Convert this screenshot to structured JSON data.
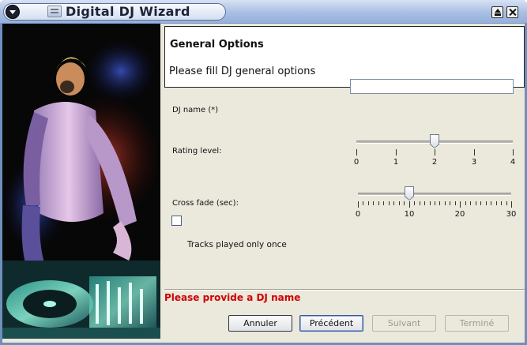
{
  "window": {
    "title": "Digital DJ Wizard"
  },
  "header": {
    "title": "General Options",
    "subtitle": "Please fill DJ general options"
  },
  "form": {
    "dj_name_label": "DJ name (*)",
    "dj_name_value": "",
    "rating_label": "Rating level:",
    "rating_ticks": [
      "0",
      "1",
      "2",
      "3",
      "4"
    ],
    "rating_value": 2,
    "crossfade_label": "Cross fade (sec):",
    "crossfade_ticks": [
      "0",
      "10",
      "20",
      "30"
    ],
    "crossfade_value": 10,
    "once_label": "Tracks played only once",
    "once_checked": false
  },
  "status": {
    "error": "Please provide a DJ name",
    "error_color": "#d00000"
  },
  "buttons": {
    "cancel": "Annuler",
    "previous": "Précédent",
    "next": "Suivant",
    "finish": "Terminé"
  },
  "icons": {
    "window_menu": "chevron-down-icon",
    "app": "wizard-app-icon",
    "maximize": "maximize-icon",
    "close": "close-icon"
  },
  "colors": {
    "title_bar": "#a9bfe3",
    "panel": "#ebe8dc"
  }
}
